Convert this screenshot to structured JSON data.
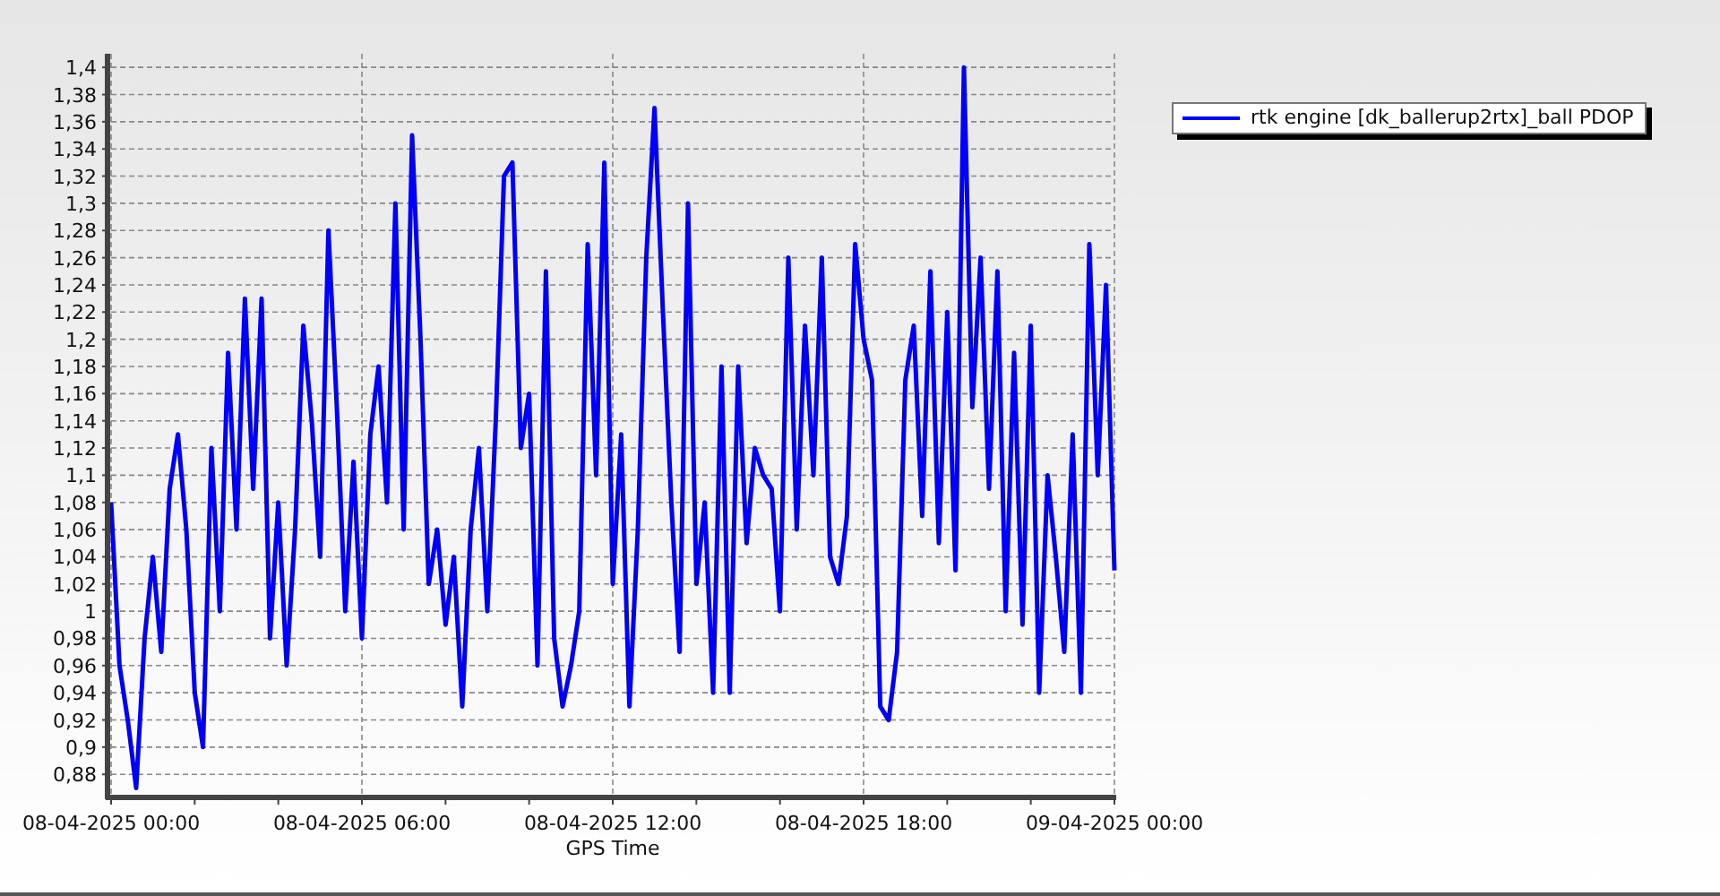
{
  "chart": {
    "chart_data": {
      "type": "line",
      "xlabel": "GPS Time",
      "categories": [
        "08-04-2025 00:00",
        null,
        null,
        null,
        null,
        null,
        null,
        null,
        null,
        null,
        null,
        null,
        null,
        null,
        null,
        null,
        null,
        null,
        null,
        null,
        null,
        null,
        null,
        null,
        null,
        null,
        null,
        null,
        null,
        null,
        "08-04-2025 06:00",
        null,
        null,
        null,
        null,
        null,
        null,
        null,
        null,
        null,
        null,
        null,
        null,
        null,
        null,
        null,
        null,
        null,
        null,
        null,
        null,
        null,
        null,
        null,
        null,
        null,
        null,
        null,
        null,
        null,
        "08-04-2025 12:00",
        null,
        null,
        null,
        null,
        null,
        null,
        null,
        null,
        null,
        null,
        null,
        null,
        null,
        null,
        null,
        null,
        null,
        null,
        null,
        null,
        null,
        null,
        null,
        null,
        null,
        null,
        null,
        null,
        null,
        "08-04-2025 18:00",
        null,
        null,
        null,
        null,
        null,
        null,
        null,
        null,
        null,
        null,
        null,
        null,
        null,
        null,
        null,
        null,
        null,
        null,
        null,
        null,
        null,
        null,
        null,
        null,
        null,
        null,
        null,
        null,
        null,
        "09-04-2025 00:00"
      ],
      "series": [
        {
          "name": "rtk engine [dk_ballerup2rtx]_ball PDOP",
          "color": "#0000ff",
          "values": [
            1.08,
            0.96,
            0.92,
            0.87,
            0.98,
            1.04,
            0.97,
            1.09,
            1.13,
            1.06,
            0.94,
            0.9,
            1.12,
            1,
            1.19,
            1.06,
            1.23,
            1.09,
            1.23,
            0.98,
            1.08,
            0.96,
            1.06,
            1.21,
            1.14,
            1.04,
            1.28,
            1.15,
            1,
            1.11,
            0.98,
            1.13,
            1.18,
            1.08,
            1.3,
            1.06,
            1.35,
            1.2,
            1.02,
            1.06,
            0.99,
            1.04,
            0.93,
            1.06,
            1.12,
            1,
            1.14,
            1.32,
            1.33,
            1.12,
            1.16,
            0.96,
            1.25,
            0.98,
            0.93,
            0.96,
            1,
            1.27,
            1.1,
            1.33,
            1.02,
            1.13,
            0.93,
            1.06,
            1.26,
            1.37,
            1.22,
            1.08,
            0.97,
            1.3,
            1.02,
            1.08,
            0.94,
            1.18,
            0.94,
            1.18,
            1.05,
            1.12,
            1.1,
            1.09,
            1,
            1.26,
            1.06,
            1.21,
            1.1,
            1.26,
            1.04,
            1.02,
            1.07,
            1.27,
            1.2,
            1.17,
            0.93,
            0.92,
            0.97,
            1.17,
            1.21,
            1.07,
            1.25,
            1.05,
            1.22,
            1.03,
            1.4,
            1.15,
            1.26,
            1.09,
            1.25,
            1,
            1.19,
            0.99,
            1.21,
            0.94,
            1.1,
            1.04,
            0.97,
            1.13,
            0.94,
            1.27,
            1.1,
            1.24,
            1.03
          ]
        }
      ],
      "grid": true,
      "ylim": [
        0.863,
        1.41
      ],
      "yticks": [
        {
          "value": 0.88,
          "label": "0,88"
        },
        {
          "value": 0.9,
          "label": "0,9"
        },
        {
          "value": 0.92,
          "label": "0,92"
        },
        {
          "value": 0.94,
          "label": "0,94"
        },
        {
          "value": 0.96,
          "label": "0,96"
        },
        {
          "value": 0.98,
          "label": "0,98"
        },
        {
          "value": 1,
          "label": "1"
        },
        {
          "value": 1.02,
          "label": "1,02"
        },
        {
          "value": 1.04,
          "label": "1,04"
        },
        {
          "value": 1.06,
          "label": "1,06"
        },
        {
          "value": 1.08,
          "label": "1,08"
        },
        {
          "value": 1.1,
          "label": "1,1"
        },
        {
          "value": 1.12,
          "label": "1,12"
        },
        {
          "value": 1.14,
          "label": "1,14"
        },
        {
          "value": 1.16,
          "label": "1,16"
        },
        {
          "value": 1.18,
          "label": "1,18"
        },
        {
          "value": 1.2,
          "label": "1,2"
        },
        {
          "value": 1.22,
          "label": "1,22"
        },
        {
          "value": 1.24,
          "label": "1,24"
        },
        {
          "value": 1.26,
          "label": "1,26"
        },
        {
          "value": 1.28,
          "label": "1,28"
        },
        {
          "value": 1.3,
          "label": "1,3"
        },
        {
          "value": 1.32,
          "label": "1,32"
        },
        {
          "value": 1.34,
          "label": "1,34"
        },
        {
          "value": 1.36,
          "label": "1,36"
        },
        {
          "value": 1.38,
          "label": "1,38"
        },
        {
          "value": 1.4,
          "label": "1,4"
        }
      ]
    }
  }
}
